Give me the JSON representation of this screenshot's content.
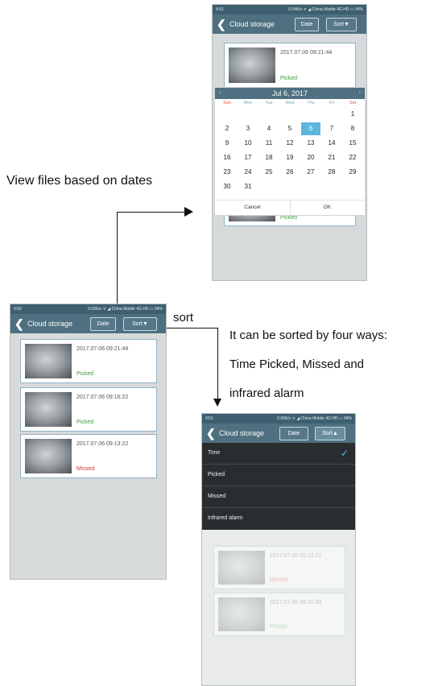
{
  "annotations": {
    "dates_caption": "View files based on dates",
    "sort_label": "sort",
    "sort_desc_1": "It can be sorted by four ways:",
    "sort_desc_2": "Time Picked, Missed and",
    "sort_desc_3": "infrared alarm"
  },
  "phone_left": {
    "status_time": "9:50",
    "status_right": "0.03K/s ᯤ ◢ China Mobile 4G HD ▭ 94%",
    "title": "Cloud storage",
    "date_button": "Date",
    "sort_button": "Sort▼",
    "cards": [
      {
        "timestamp": "2017.07.06 09:21:44",
        "status": "Picked"
      },
      {
        "timestamp": "2017.07.06 09:16:22",
        "status": "Picked"
      },
      {
        "timestamp": "2017.07.06 09:13:22",
        "status": "Missed"
      }
    ]
  },
  "phone_top": {
    "status_time": "9:51",
    "status_right": "0.04K/s ᯤ ◢ China Mobile 4G HD ▭ 94%",
    "title": "Cloud storage",
    "date_button": "Date",
    "sort_button": "Sort▼",
    "card_top": {
      "timestamp": "2017.07.06 09:21:44",
      "status": "Picked"
    },
    "card_bottom_status": "Picked",
    "calendar": {
      "month_label": "Jul 6, 2017",
      "prev": "‹",
      "next": "›",
      "weekdays": [
        "Sun",
        "Mon",
        "Tue",
        "Wed",
        "Thu",
        "Fri",
        "Sat"
      ],
      "weeks": [
        [
          "",
          "",
          "",
          "",
          "",
          "",
          "1"
        ],
        [
          "2",
          "3",
          "4",
          "5",
          "6",
          "7",
          "8"
        ],
        [
          "9",
          "10",
          "11",
          "12",
          "13",
          "14",
          "15"
        ],
        [
          "16",
          "17",
          "18",
          "19",
          "20",
          "21",
          "22"
        ],
        [
          "23",
          "24",
          "25",
          "26",
          "27",
          "28",
          "29"
        ],
        [
          "30",
          "31",
          "",
          "",
          "",
          "",
          ""
        ]
      ],
      "selected_day": "6",
      "cancel": "Cancel",
      "ok": "OK"
    }
  },
  "phone_bottom": {
    "status_time": "9:51",
    "status_right": "0.09K/s ᯤ ◢ China Mobile 4G HD ▭ 94%",
    "title": "Cloud storage",
    "date_button": "Date",
    "sort_button": "Sort▲",
    "menu": [
      {
        "label": "Time",
        "checked": true
      },
      {
        "label": "Picked",
        "checked": false
      },
      {
        "label": "Missed",
        "checked": false
      },
      {
        "label": "Infrared alarm",
        "checked": false
      }
    ],
    "check_mark": "✓",
    "dim_cards": [
      {
        "timestamp": "2017.07.06 09:13:22",
        "status": "Missed"
      },
      {
        "timestamp": "2017.07.06 09:10:59",
        "status": "Picked"
      }
    ]
  },
  "colors": {
    "header": "#4e7080",
    "statusbar": "#3d5f6f",
    "picked": "#3c9a3c",
    "missed": "#e03030",
    "selected_day": "#5db7de"
  }
}
